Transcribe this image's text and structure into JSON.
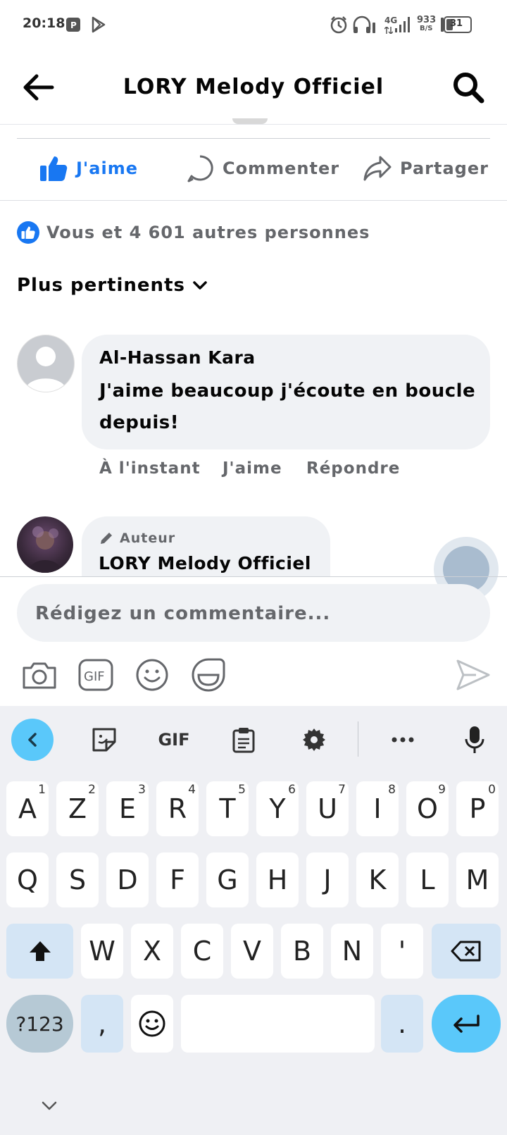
{
  "status_bar": {
    "time": "20:18",
    "net_type": "4G",
    "net_speed_value": "933",
    "net_speed_unit": "B/S",
    "battery": "31"
  },
  "header": {
    "title": "LORY Melody Officiel"
  },
  "actions": {
    "like": "J'aime",
    "comment": "Commenter",
    "share": "Partager"
  },
  "reactions": {
    "text": "Vous et 4 601 autres personnes"
  },
  "sort": {
    "label": "Plus pertinents"
  },
  "comments": [
    {
      "name": "Al-Hassan Kara",
      "text": "J'aime beaucoup j'écoute en boucle depuis!",
      "time": "À l'instant",
      "like": "J'aime",
      "reply": "Répondre"
    },
    {
      "badge": "Auteur",
      "name": "LORY Melody Officiel"
    }
  ],
  "composer": {
    "placeholder": "Rédigez un commentaire..."
  },
  "keyboard": {
    "toolbar_gif": "GIF",
    "row1": [
      {
        "k": "A",
        "n": "1"
      },
      {
        "k": "Z",
        "n": "2"
      },
      {
        "k": "E",
        "n": "3"
      },
      {
        "k": "R",
        "n": "4"
      },
      {
        "k": "T",
        "n": "5"
      },
      {
        "k": "Y",
        "n": "6"
      },
      {
        "k": "U",
        "n": "7"
      },
      {
        "k": "I",
        "n": "8"
      },
      {
        "k": "O",
        "n": "9"
      },
      {
        "k": "P",
        "n": "0"
      }
    ],
    "row2": [
      "Q",
      "S",
      "D",
      "F",
      "G",
      "H",
      "J",
      "K",
      "L",
      "M"
    ],
    "row3": [
      "W",
      "X",
      "C",
      "V",
      "B",
      "N",
      "'"
    ],
    "sym": "?123",
    "comma": ",",
    "period": "."
  }
}
